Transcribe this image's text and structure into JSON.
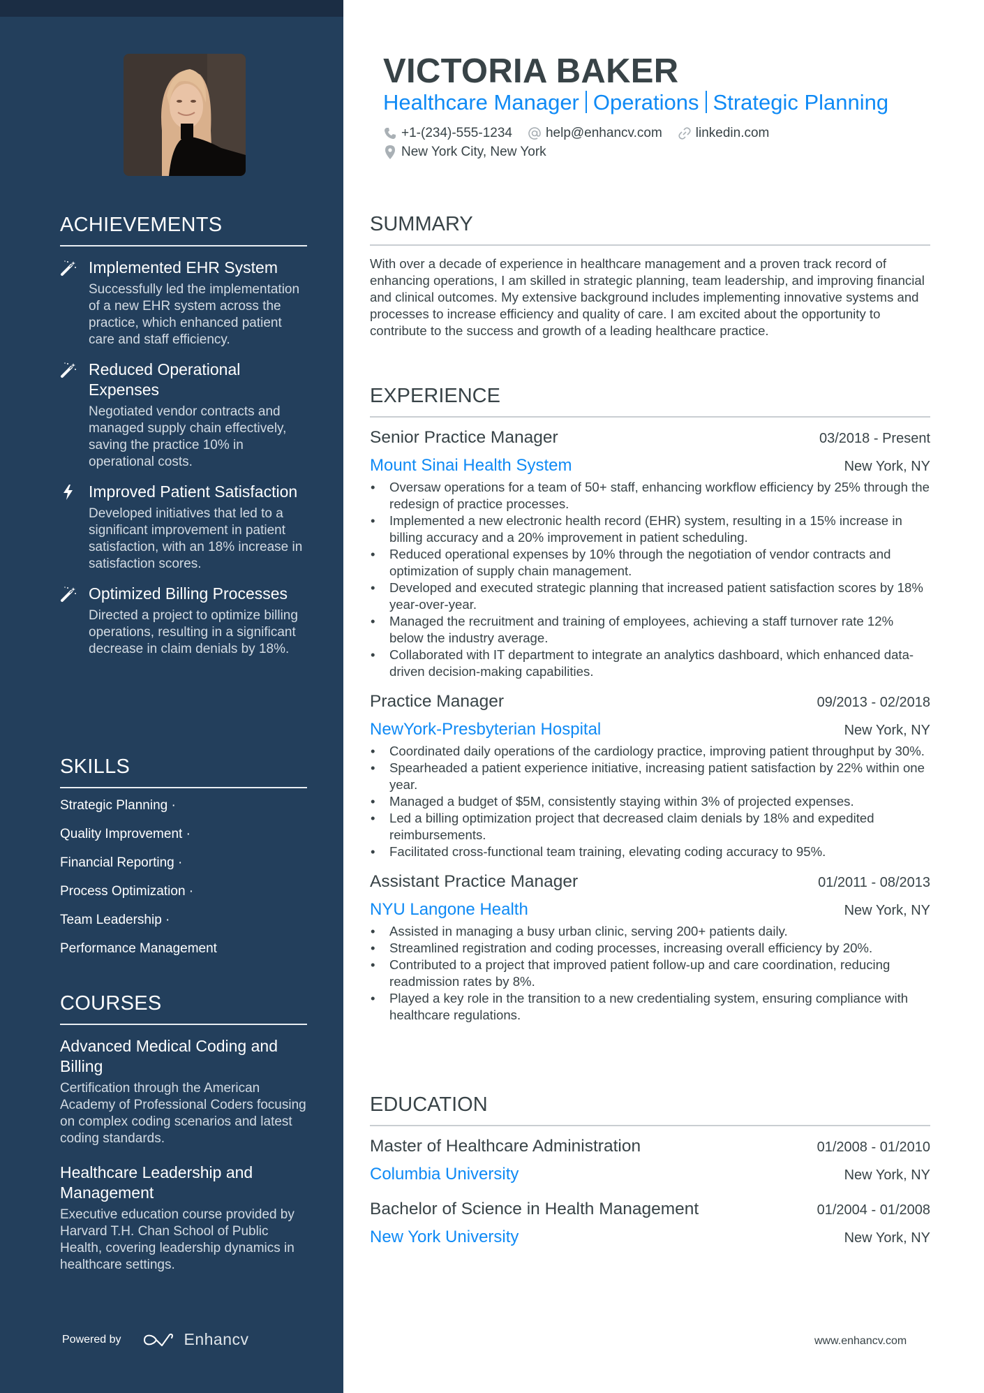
{
  "profile": {
    "name": "VICTORIA BAKER",
    "headline_parts": [
      "Healthcare Manager",
      "Operations",
      "Strategic Planning"
    ],
    "phone": "+1-(234)-555-1234",
    "email": "help@enhancv.com",
    "website": "linkedin.com",
    "location": "New York City, New York",
    "photo_alt": "Profile photo of Victoria Baker"
  },
  "colors": {
    "sidebar": "#233F5C",
    "sidebar_top": "#1B2D44",
    "accent": "#0F8AF5",
    "text": "#384347"
  },
  "sidebar": {
    "achievements": {
      "heading": "ACHIEVEMENTS",
      "items": [
        {
          "icon": "magic-wand-icon",
          "title": "Implemented EHR System",
          "description": "Successfully led the implementation of a new EHR system across the practice, which enhanced patient care and staff efficiency."
        },
        {
          "icon": "magic-wand-icon",
          "title": "Reduced Operational Expenses",
          "description": "Negotiated vendor contracts and managed supply chain effectively, saving the practice 10% in operational costs."
        },
        {
          "icon": "lightning-bolt-icon",
          "title": "Improved Patient Satisfaction",
          "description": "Developed initiatives that led to a significant improvement in patient satisfaction, with an 18% increase in satisfaction scores."
        },
        {
          "icon": "magic-wand-icon",
          "title": "Optimized Billing Processes",
          "description": "Directed a project to optimize billing operations, resulting in a significant decrease in claim denials by 18%."
        }
      ]
    },
    "skills": {
      "heading": "SKILLS",
      "items": [
        "Strategic Planning ·",
        "Quality Improvement ·",
        "Financial Reporting ·",
        "Process Optimization ·",
        "Team Leadership ·",
        "Performance Management"
      ]
    },
    "courses": {
      "heading": "COURSES",
      "items": [
        {
          "title": "Advanced Medical Coding and Billing",
          "description": "Certification through the American Academy of Professional Coders focusing on complex coding scenarios and latest coding standards."
        },
        {
          "title": "Healthcare Leadership and Management",
          "description": "Executive education course provided by Harvard T.H. Chan School of Public Health, covering leadership dynamics in healthcare settings."
        }
      ]
    },
    "powered_by": "Powered by",
    "brand": "Enhancv"
  },
  "main": {
    "summary": {
      "heading": "SUMMARY",
      "text": "With over a decade of experience in healthcare management and a proven track record of enhancing operations, I am skilled in strategic planning, team leadership, and improving financial and clinical outcomes. My extensive background includes implementing innovative systems and processes to increase efficiency and quality of care. I am excited about the opportunity to contribute to the success and growth of a leading healthcare practice."
    },
    "experience": {
      "heading": "EXPERIENCE",
      "jobs": [
        {
          "title": "Senior Practice Manager",
          "dates": "03/2018 - Present",
          "company": "Mount Sinai Health System",
          "location": "New York, NY",
          "bullets": [
            "Oversaw operations for a team of 50+ staff, enhancing workflow efficiency by 25% through the redesign of practice processes.",
            "Implemented a new electronic health record (EHR) system, resulting in a 15% increase in billing accuracy and a 20% improvement in patient scheduling.",
            "Reduced operational expenses by 10% through the negotiation of vendor contracts and optimization of supply chain management.",
            "Developed and executed strategic planning that increased patient satisfaction scores by 18% year-over-year.",
            "Managed the recruitment and training of employees, achieving a staff turnover rate 12% below the industry average.",
            "Collaborated with IT department to integrate an analytics dashboard, which enhanced data-driven decision-making capabilities."
          ]
        },
        {
          "title": "Practice Manager",
          "dates": "09/2013 - 02/2018",
          "company": "NewYork-Presbyterian Hospital",
          "location": "New York, NY",
          "bullets": [
            "Coordinated daily operations of the cardiology practice, improving patient throughput by 30%.",
            "Spearheaded a patient experience initiative, increasing patient satisfaction by 22% within one year.",
            "Managed a budget of $5M, consistently staying within 3% of projected expenses.",
            "Led a billing optimization project that decreased claim denials by 18% and expedited reimbursements.",
            "Facilitated cross-functional team training, elevating coding accuracy to 95%."
          ]
        },
        {
          "title": "Assistant Practice Manager",
          "dates": "01/2011 - 08/2013",
          "company": "NYU Langone Health",
          "location": "New York, NY",
          "bullets": [
            "Assisted in managing a busy urban clinic, serving 200+ patients daily.",
            "Streamlined registration and coding processes, increasing overall efficiency by 20%.",
            "Contributed to a project that improved patient follow-up and care coordination, reducing readmission rates by 8%.",
            "Played a key role in the transition to a new credentialing system, ensuring compliance with healthcare regulations."
          ]
        }
      ]
    },
    "education": {
      "heading": "EDUCATION",
      "items": [
        {
          "degree": "Master of Healthcare Administration",
          "dates": "01/2008 - 01/2010",
          "school": "Columbia University",
          "location": "New York, NY"
        },
        {
          "degree": "Bachelor of Science in Health Management",
          "dates": "01/2004 - 01/2008",
          "school": "New York University",
          "location": "New York, NY"
        }
      ]
    },
    "footer_url": "www.enhancv.com"
  }
}
